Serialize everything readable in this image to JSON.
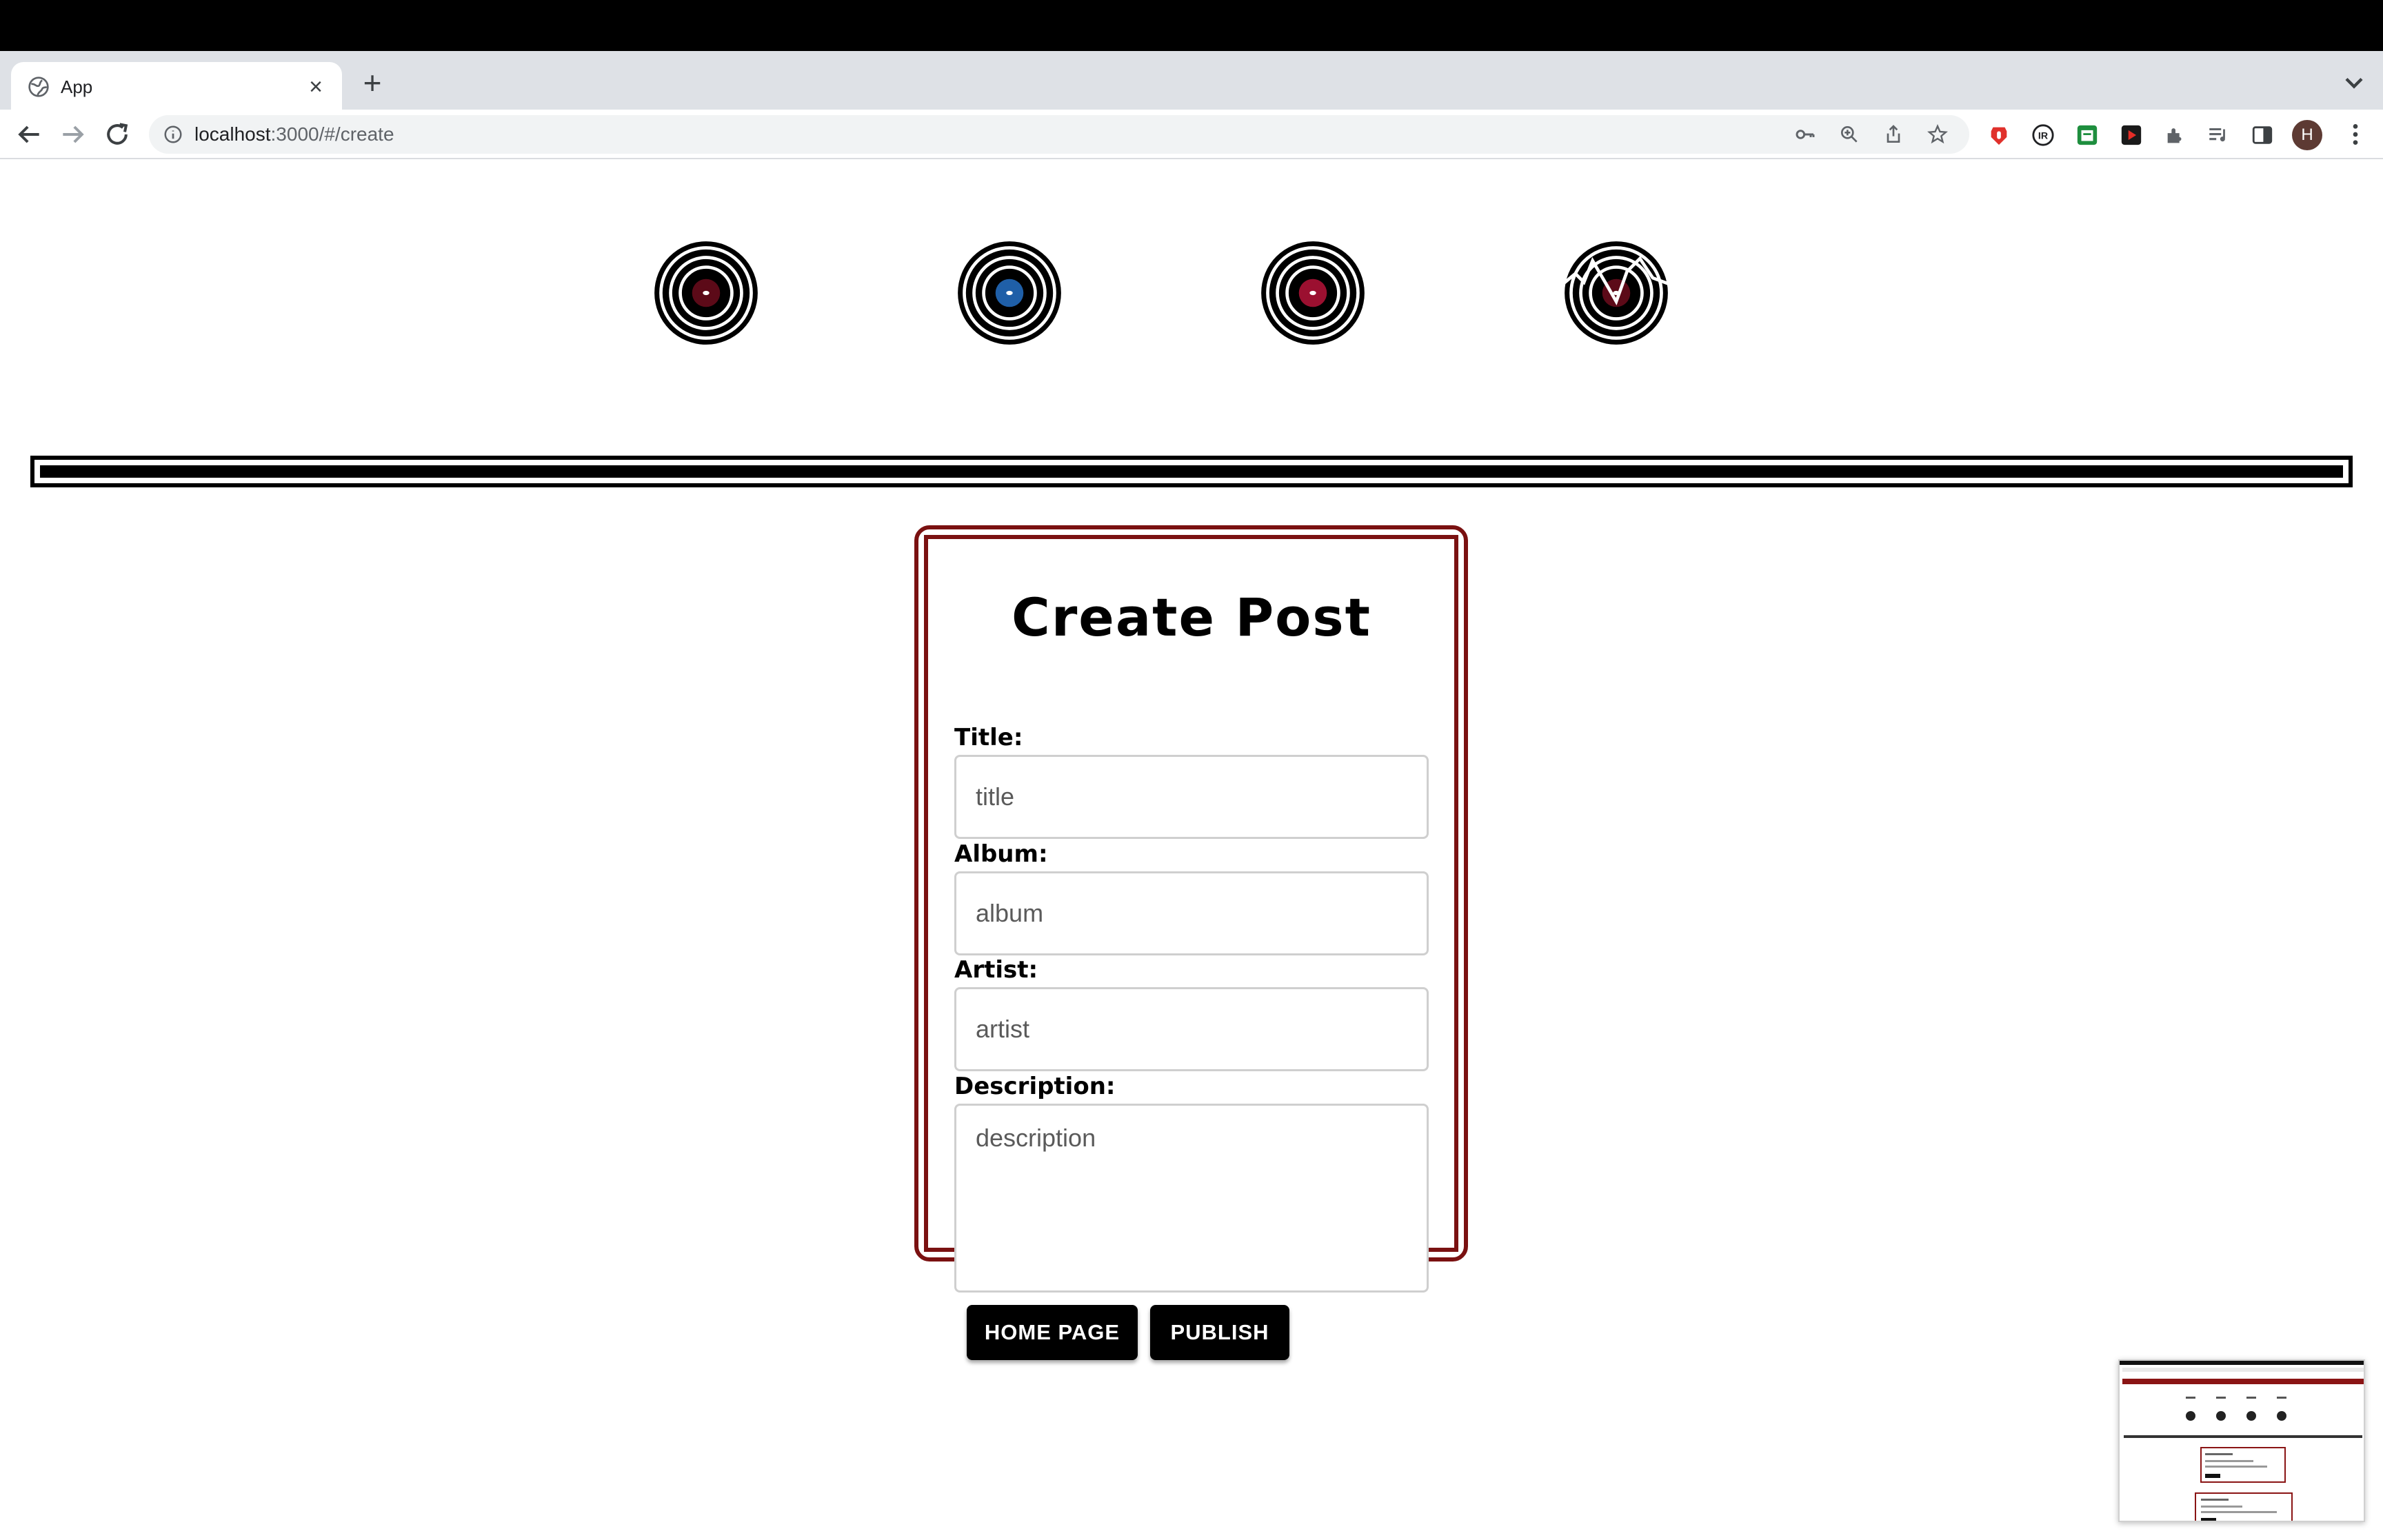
{
  "browser": {
    "tab_title": "App",
    "url_host": "localhost",
    "url_rest": ":3000/#/create"
  },
  "page": {
    "title": "Create Post"
  },
  "nav_records": [
    {
      "name": "record-1",
      "label_color": "#5c0a18"
    },
    {
      "name": "record-2",
      "label_color": "#1f5fa8"
    },
    {
      "name": "record-3",
      "label_color": "#9b1030"
    },
    {
      "name": "record-4",
      "label_color": "#5c0a18"
    }
  ],
  "form": {
    "title_label": "Title:",
    "title_placeholder": "title",
    "album_label": "Album:",
    "album_placeholder": "album",
    "artist_label": "Artist:",
    "artist_placeholder": "artist",
    "description_label": "Description:",
    "description_placeholder": "description",
    "home_button": "HOME PAGE",
    "publish_button": "PUBLISH"
  },
  "colors": {
    "accent": "#7a1111",
    "button_bg": "#000000"
  }
}
